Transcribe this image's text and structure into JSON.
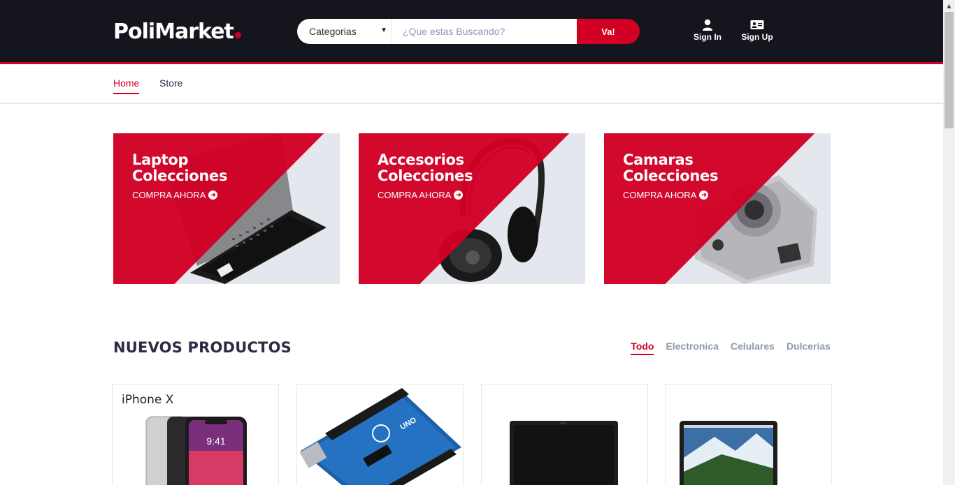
{
  "header": {
    "logo_text": "PoliMarket",
    "search": {
      "category_selected": "Categorias",
      "placeholder": "¿Que estas Buscando?",
      "button_label": "Va!"
    },
    "account": {
      "sign_in": "Sign In",
      "sign_up": "Sign Up"
    }
  },
  "nav": {
    "items": [
      {
        "label": "Home",
        "active": true
      },
      {
        "label": "Store",
        "active": false
      }
    ]
  },
  "collections": [
    {
      "title_line1": "Laptop",
      "title_line2": "Colecciones",
      "cta": "COMPRA AHORA",
      "icon": "laptop-image"
    },
    {
      "title_line1": "Accesorios",
      "title_line2": "Colecciones",
      "cta": "COMPRA AHORA",
      "icon": "headphones-image"
    },
    {
      "title_line1": "Camaras",
      "title_line2": "Colecciones",
      "cta": "COMPRA AHORA",
      "icon": "camera-image"
    }
  ],
  "new_products": {
    "title": "NUEVOS PRODUCTOS",
    "tabs": [
      {
        "label": "Todo",
        "active": true
      },
      {
        "label": "Electronica",
        "active": false
      },
      {
        "label": "Celulares",
        "active": false
      },
      {
        "label": "Dulcerias",
        "active": false
      }
    ],
    "cards": [
      {
        "label": "iPhone X",
        "icon": "iphone-image",
        "time": "9:41"
      },
      {
        "label": "",
        "icon": "arduino-board-image",
        "board_text": "UNO"
      },
      {
        "label": "",
        "icon": "laptop-image"
      },
      {
        "label": "",
        "icon": "tablet-image"
      }
    ]
  },
  "colors": {
    "accent": "#d10024",
    "header_bg": "#15161d",
    "muted_text": "#8d99ae",
    "dark_text": "#2b2d42"
  }
}
